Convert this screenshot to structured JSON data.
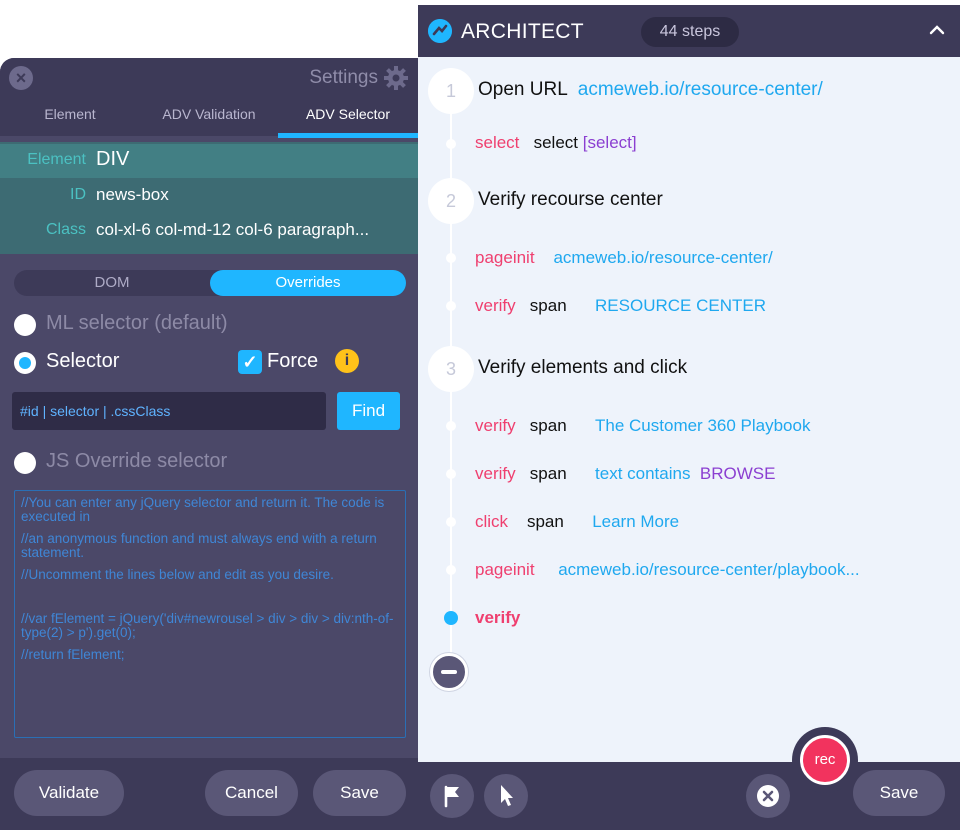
{
  "settings": {
    "title": "Settings",
    "tabs": [
      "Element",
      "ADV Validation",
      "ADV Selector"
    ],
    "element": {
      "element_label": "Element",
      "element_value": "DIV",
      "id_label": "ID",
      "id_value": "news-box",
      "class_label": "Class",
      "class_value": "col-xl-6 col-md-12 col-6 paragraph..."
    },
    "toggle": {
      "dom": "DOM",
      "overrides": "Overrides"
    },
    "ml_selector": "ML selector",
    "ml_default": "(default)",
    "selector": "Selector",
    "force": "Force",
    "info": "i",
    "selector_input_value": "#id | selector | .cssClass",
    "find": "Find",
    "js_override": "JS Override selector",
    "code_lines": [
      "//You can enter any jQuery selector and return it. The code is executed in",
      "//an anonymous function and must always end with a return statement.",
      "//Uncomment the lines below and edit as you desire.",
      "",
      "//var fElement = jQuery('div#newrousel > div > div > div:nth-of-type(2) > p').get(0);",
      "//return fElement;"
    ],
    "buttons": {
      "validate": "Validate",
      "cancel": "Cancel",
      "save": "Save"
    }
  },
  "architect": {
    "title": "ARCHITECT",
    "steps_badge": "44 steps",
    "steps": [
      {
        "number": "1",
        "title": "Open URL",
        "url": "acmeweb.io/resource-center/"
      },
      {
        "number": "2",
        "title": "Verify recourse center"
      },
      {
        "number": "3",
        "title": "Verify elements and click"
      }
    ],
    "rows": {
      "r1": {
        "kw": "select",
        "tag": "select",
        "extra": "[select]"
      },
      "r2": {
        "kw": "pageinit",
        "value": "acmeweb.io/resource-center/"
      },
      "r3": {
        "kw": "verify",
        "tag": "span",
        "value": "RESOURCE CENTER"
      },
      "r4": {
        "kw": "verify",
        "tag": "span",
        "value": "The Customer 360 Playbook"
      },
      "r5": {
        "kw": "verify",
        "tag": "span",
        "value": "text contains",
        "extra": "BROWSE"
      },
      "r6": {
        "kw": "click",
        "tag": "span",
        "value": "Learn More"
      },
      "r7": {
        "kw": "pageinit",
        "value": "acmeweb.io/resource-center/playbook..."
      },
      "r8": {
        "kw": "verify"
      }
    },
    "rec": "rec",
    "save": "Save"
  },
  "colors": {
    "panel_bg": "#4b4868",
    "header_bg": "#3d3a58",
    "accent_blue": "#1fb6ff",
    "keyword_pink": "#ef3f6f",
    "purple": "#8b3fd1",
    "rec_red": "#f2335e"
  },
  "icons": [
    "close-icon",
    "gear-icon",
    "info-icon",
    "architect-logo-icon",
    "chevron-up-icon",
    "minus-icon",
    "flag-icon",
    "pointer-icon",
    "close-circle-icon"
  ]
}
